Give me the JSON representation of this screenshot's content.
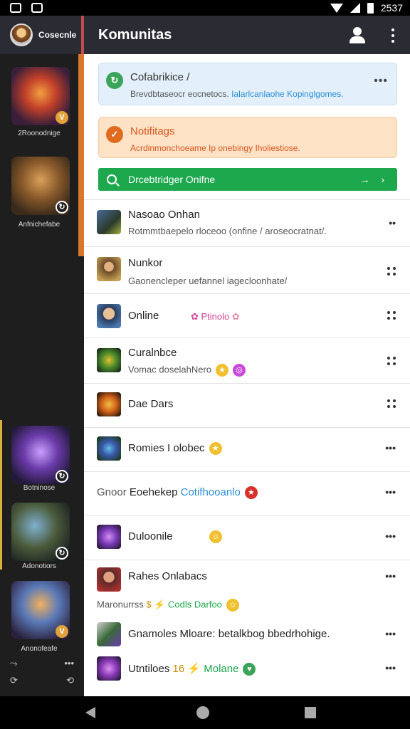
{
  "status_bar": {
    "time": "2537"
  },
  "sidebar": {
    "username": "Cosecnle",
    "tiles": [
      {
        "caption": "2Roonodnige",
        "badge": "V"
      },
      {
        "caption": "Anfnichefabe",
        "badge": "↻"
      },
      {
        "caption": "Botninose",
        "badge": "↻"
      },
      {
        "caption": "Adonotiors",
        "badge": "↻"
      },
      {
        "caption": "Anonofeafe",
        "badge": "V"
      }
    ],
    "footer": {
      "left_top": "⤳",
      "right_top": "•••",
      "left_bottom": "⟳",
      "right_bottom": "⟲"
    }
  },
  "appbar": {
    "title": "Komunitas"
  },
  "cards": {
    "info": {
      "title": "Cofabrikice /",
      "body": "Brevdbtaseocr eocnetocs.",
      "body_highlight": "Ialarlcanlaohe Kopinglgomes.",
      "more": "•••"
    },
    "warn": {
      "title": "Notifitags",
      "body": "Acrdinmonchoeame Ip onebingy Iholiestiose."
    }
  },
  "search": {
    "label": "Drcebtridger Onifne",
    "trail": "→ ›"
  },
  "rows": [
    {
      "title": "Nasoao Onhan",
      "sub": "Rotmmtbaepelo rloceoo (onfine / aroseocratnat/."
    },
    {
      "title": "Nunkor",
      "sub": "Gaonencleper uefannel iagecloonhate/"
    },
    {
      "title": "Online",
      "tag": "Ptinolo"
    },
    {
      "title": "Curalnbce",
      "sub": "Vomac doselahNero"
    },
    {
      "title": "Dae Dars"
    },
    {
      "title": "Romies I olobec"
    },
    {
      "prefix": "Gnoor",
      "title": "Eoehekep",
      "tag": "Cotifhooanlo"
    },
    {
      "title": "Duloonile"
    },
    {
      "title": "Rahes Onlabacs",
      "prefix2": "Maronurrss",
      "tag2": "Codls Darfoo"
    },
    {
      "title": "Gnamoles Mloare: betalkbog bbedrhohige."
    },
    {
      "title": "Utntiloes",
      "tag": "Molane"
    }
  ],
  "colors": {
    "accent_green": "#1ea84d",
    "accent_orange": "#d9772f",
    "appbar": "#2b2c33"
  }
}
